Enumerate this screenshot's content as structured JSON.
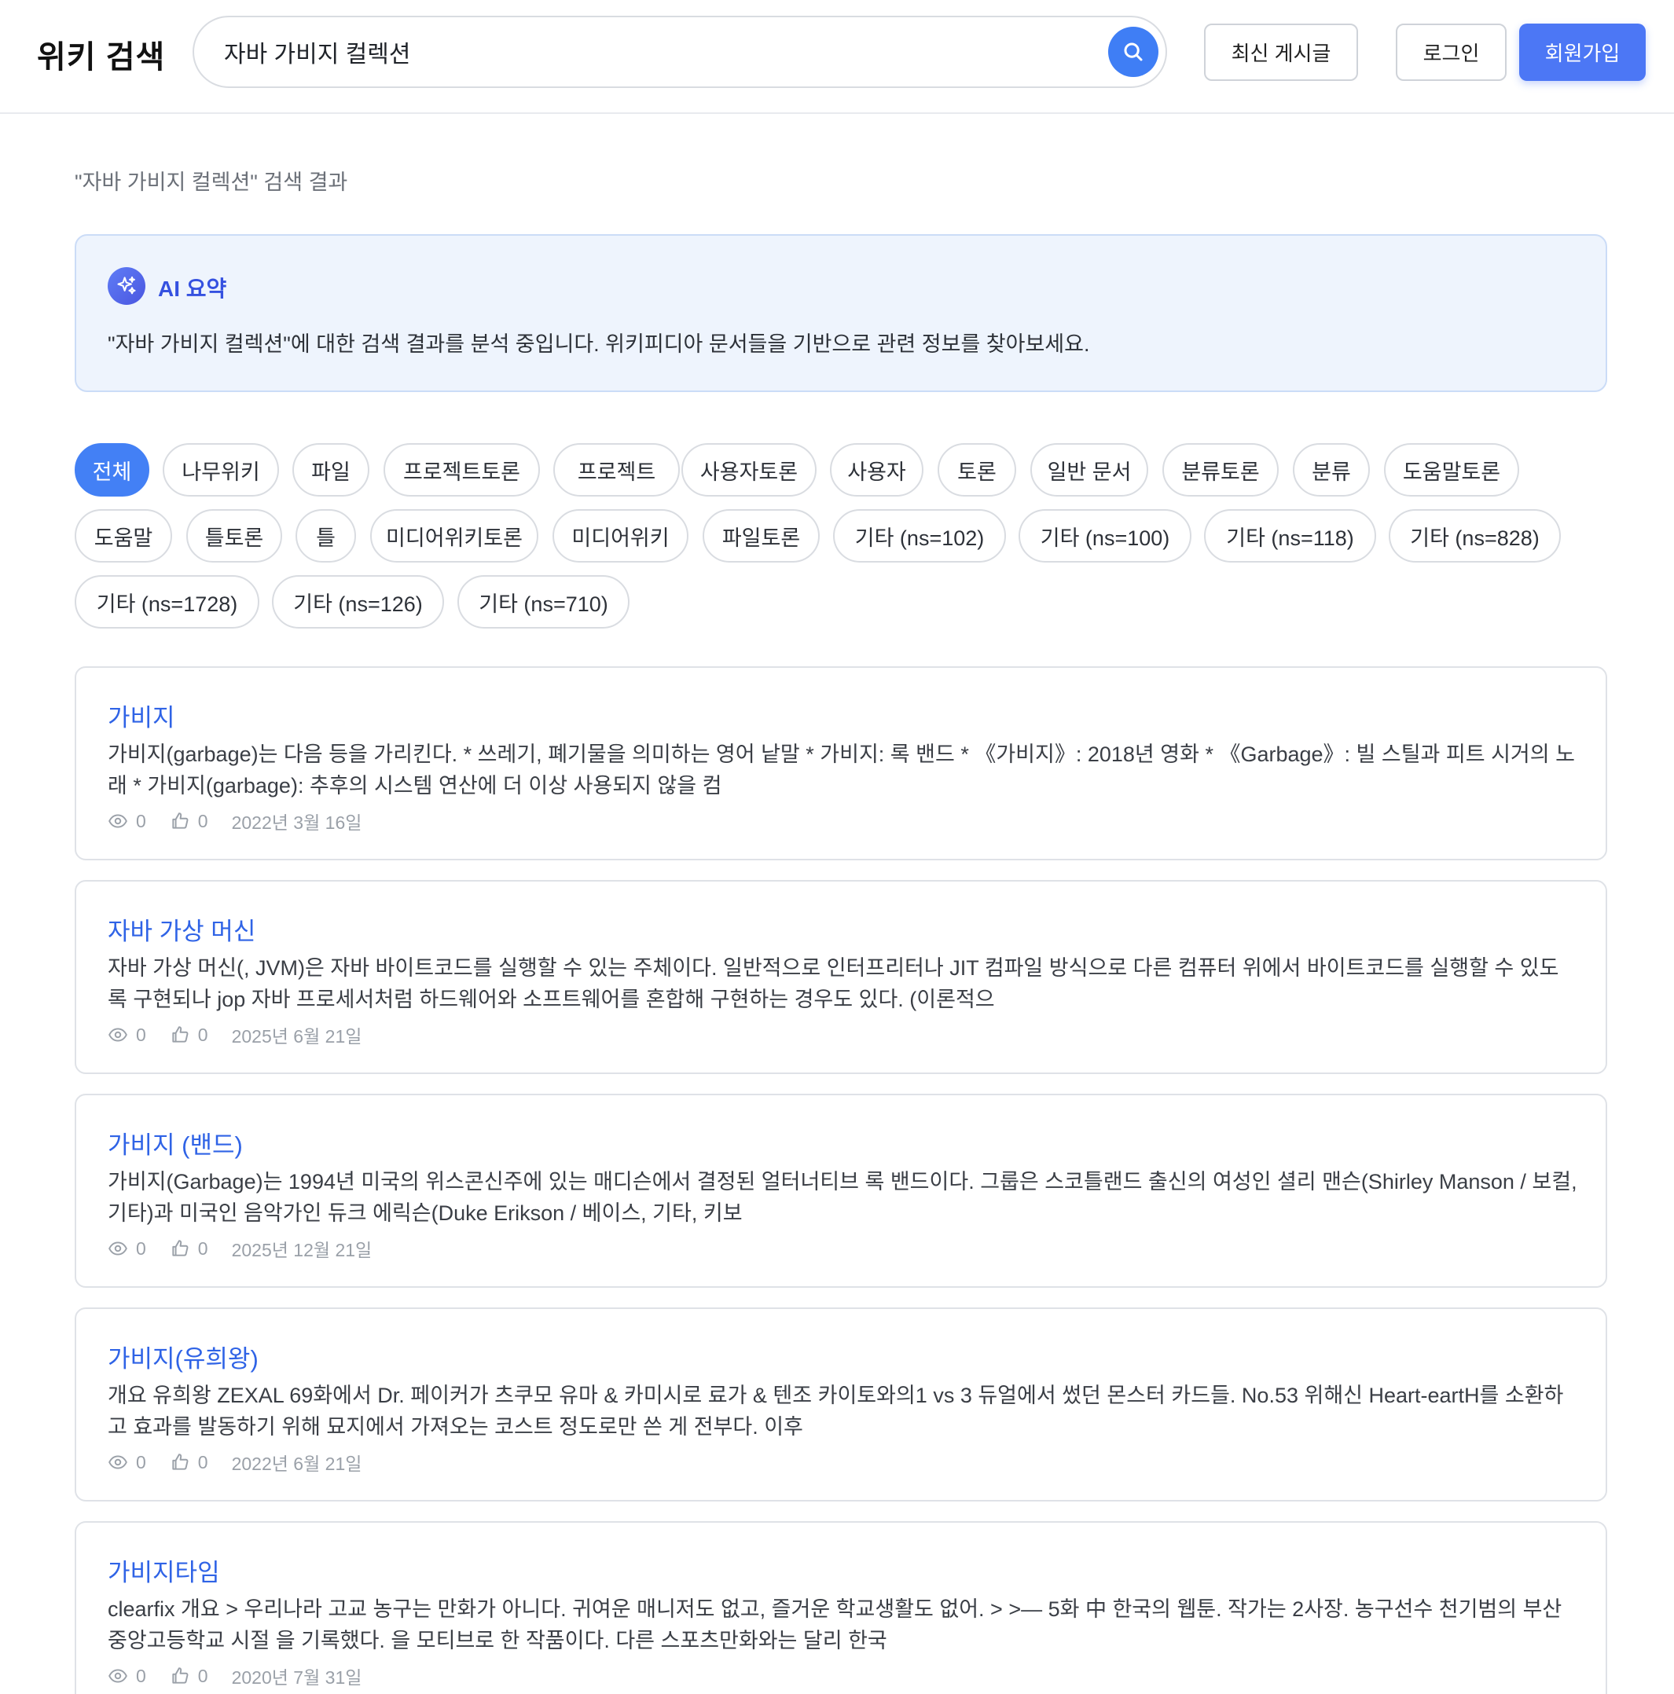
{
  "header": {
    "logo": "위키 검색",
    "search_value": "자바 가비지 컬렉션",
    "recent_posts": "최신 게시글",
    "login": "로그인",
    "signup": "회원가입"
  },
  "results_label": "\"자바 가비지 컬렉션\" 검색 결과",
  "ai_summary": {
    "title": "AI 요약",
    "text": "\"자바 가비지 컬렉션\"에 대한 검색 결과를 분석 중입니다. 위키피디아 문서들을 기반으로 관련 정보를 찾아보세요."
  },
  "filters": [
    "전체",
    "나무위키",
    "파일",
    "프로젝트토론",
    "프로젝트",
    "사용자토론",
    "사용자",
    "토론",
    "일반 문서",
    "분류토론",
    "분류",
    "도움말토론",
    "도움말",
    "틀토론",
    "틀",
    "미디어위키토론",
    "미디어위키",
    "파일토론",
    "기타 (ns=102)",
    "기타 (ns=100)",
    "기타 (ns=118)",
    "기타 (ns=828)",
    "기타 (ns=1728)",
    "기타 (ns=126)",
    "기타 (ns=710)"
  ],
  "active_filter": "전체",
  "results": [
    {
      "title": "가비지",
      "snippet": "가비지(garbage)는 다음 등을 가리킨다. * 쓰레기, 폐기물을 의미하는 영어 낱말 * 가비지: 록 밴드 * 《가비지》: 2018년 영화 * 《Garbage》: 빌 스틸과 피트 시거의 노래 * 가비지(garbage): 추후의 시스템 연산에 더 이상 사용되지 않을 컴",
      "views": "0",
      "likes": "0",
      "date": "2022년 3월 16일"
    },
    {
      "title": "자바 가상 머신",
      "snippet": "자바 가상 머신(, JVM)은 자바 바이트코드를 실행할 수 있는 주체이다. 일반적으로 인터프리터나 JIT 컴파일 방식으로 다른 컴퓨터 위에서 바이트코드를 실행할 수 있도록 구현되나 jop 자바 프로세서처럼 하드웨어와 소프트웨어를 혼합해 구현하는 경우도 있다. (이론적으",
      "views": "0",
      "likes": "0",
      "date": "2025년 6월 21일"
    },
    {
      "title": "가비지 (밴드)",
      "snippet": "가비지(Garbage)는 1994년 미국의 위스콘신주에 있는 매디슨에서 결정된 얼터너티브 록 밴드이다. 그룹은 스코틀랜드 출신의 여성인 셜리 맨슨(Shirley Manson / 보컬, 기타)과 미국인 음악가인 듀크 에릭슨(Duke Erikson / 베이스, 기타, 키보",
      "views": "0",
      "likes": "0",
      "date": "2025년 12월 21일"
    },
    {
      "title": "가비지(유희왕)",
      "snippet": "개요 유희왕 ZEXAL 69화에서 Dr. 페이커가 츠쿠모 유마 & 카미시로 료가 & 텐조 카이토와의1 vs 3 듀얼에서 썼던 몬스터 카드들. No.53 위해신 Heart-eartH를 소환하고 효과를 발동하기 위해 묘지에서 가져오는 코스트 정도로만 쓴 게 전부다. 이후",
      "views": "0",
      "likes": "0",
      "date": "2022년 6월 21일"
    },
    {
      "title": "가비지타임",
      "snippet": "clearfix 개요 > 우리나라 고교 농구는 만화가 아니다. 귀여운 매니저도 없고, 즐거운 학교생활도 없어. > >— 5화 中 한국의 웹툰. 작가는 2사장. 농구선수 천기범의 부산중앙고등학교 시절 을 기록했다. 을 모티브로 한 작품이다. 다른 스포츠만화와는 달리 한국",
      "views": "0",
      "likes": "0",
      "date": "2020년 7월 31일"
    }
  ]
}
